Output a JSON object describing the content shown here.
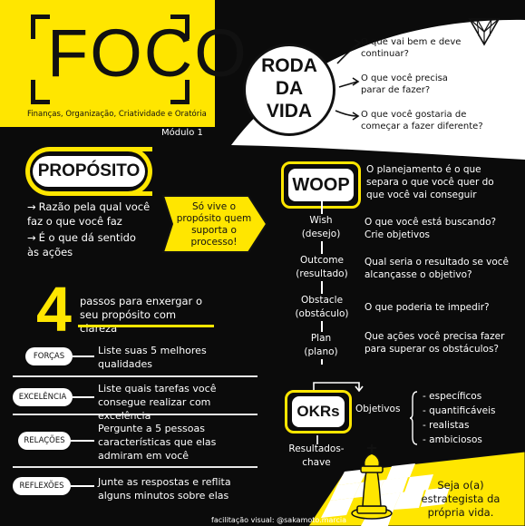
{
  "header": {
    "title": "FOCO",
    "subtitle": "Finanças, Organização, Criatividade e Oratória",
    "module": "Módulo 1"
  },
  "roda": {
    "title_lines": [
      "RODA",
      "DA",
      "VIDA"
    ],
    "questions": [
      "O que vai bem e deve continuar?",
      "O que você precisa parar de fazer?",
      "O que você gostaria de começar a fazer diferente?"
    ]
  },
  "proposito": {
    "title": "PROPÓSITO",
    "items": [
      "Razão pela qual você faz o que você faz",
      "É o que dá sentido às ações"
    ],
    "callout": "Só vive o propósito quem suporta o processo!"
  },
  "passos": {
    "number": "4",
    "title": "passos para enxergar o seu propósito com clareza",
    "steps": [
      {
        "name": "FORÇAS",
        "text": "Liste suas 5 melhores qualidades"
      },
      {
        "name": "EXCELÊNCIA",
        "text": "Liste quais tarefas você consegue realizar com excelência"
      },
      {
        "name": "RELAÇÕES",
        "text": "Pergunte a 5 pessoas características que elas admiram em você"
      },
      {
        "name": "REFLEXÕES",
        "text": "Junte as respostas e reflita alguns minutos sobre elas"
      }
    ]
  },
  "woop": {
    "title": "WOOP",
    "intro": "O planejamento é o que separa o que você quer do que você vai conseguir",
    "rows": [
      {
        "term": "Wish",
        "translation": "(desejo)",
        "desc": "O que você está buscando? Crie objetivos"
      },
      {
        "term": "Outcome",
        "translation": "(resultado)",
        "desc": "Qual seria o resultado se você alcançasse o objetivo?"
      },
      {
        "term": "Obstacle",
        "translation": "(obstáculo)",
        "desc": "O que poderia te impedir?"
      },
      {
        "term": "Plan",
        "translation": "(plano)",
        "desc": "Que ações você precisa fazer para superar os obstáculos?"
      }
    ]
  },
  "okrs": {
    "title": "OKRs",
    "objectives_label": "Objetivos",
    "results_label": "Resultados-chave",
    "objectives": [
      "específicos",
      "quantificáveis",
      "realistas",
      "ambiciosos"
    ]
  },
  "closing": {
    "text": "Seja o(a) estrategista da própria vida.",
    "credit": "facilitação visual: @sakamoto.marcia"
  },
  "colors": {
    "background": "#0b0b0b",
    "accent": "#ffe600",
    "panel": "#ffffff"
  }
}
